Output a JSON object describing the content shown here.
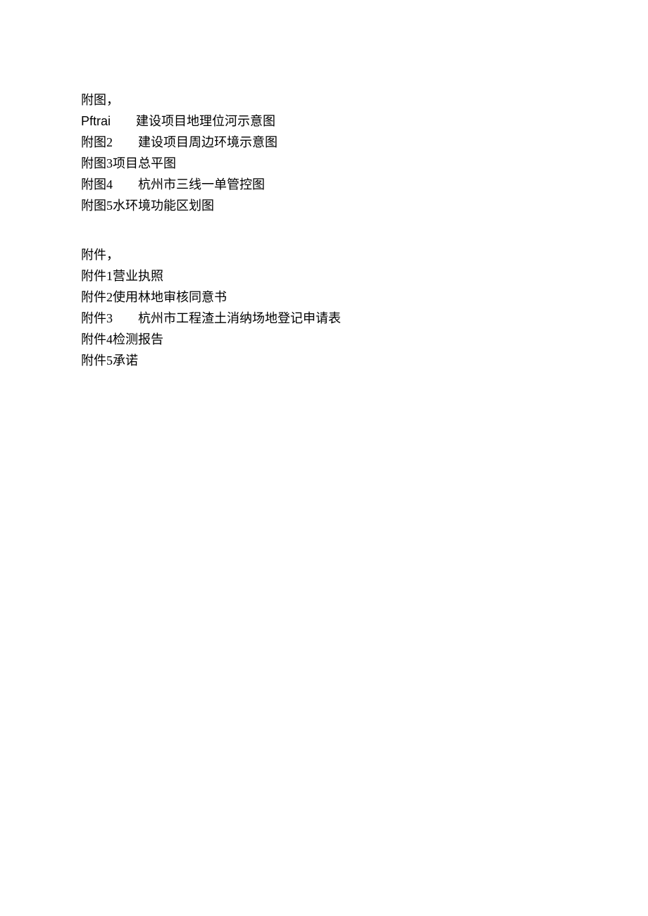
{
  "sections": {
    "figures": {
      "heading": "附图，",
      "items": [
        {
          "label": "Pftrai",
          "label_is_latin": true,
          "gap": "        ",
          "text": "建设项目地理位河示意图"
        },
        {
          "label": "附图2",
          "label_is_latin": false,
          "gap": "        ",
          "text": "建设项目周边环境示意图"
        },
        {
          "label": "附图3",
          "label_is_latin": false,
          "gap": "",
          "text": "项目总平图"
        },
        {
          "label": "附图4",
          "label_is_latin": false,
          "gap": "        ",
          "text": "杭州市三线一单管控图"
        },
        {
          "label": "附图5",
          "label_is_latin": false,
          "gap": "",
          "text": "水环境功能区划图"
        }
      ]
    },
    "attachments": {
      "heading": "附件，",
      "items": [
        {
          "label": "附件1",
          "label_is_latin": false,
          "gap": "",
          "text": "营业执照"
        },
        {
          "label": "附件2",
          "label_is_latin": false,
          "gap": "",
          "text": "使用林地审核同意书"
        },
        {
          "label": "附件3",
          "label_is_latin": false,
          "gap": "        ",
          "text": "杭州市工程渣土消纳场地登记申请表"
        },
        {
          "label": "附件4",
          "label_is_latin": false,
          "gap": "",
          "text": "检测报告"
        },
        {
          "label": "附件5",
          "label_is_latin": false,
          "gap": "",
          "text": "承诺"
        }
      ]
    }
  }
}
